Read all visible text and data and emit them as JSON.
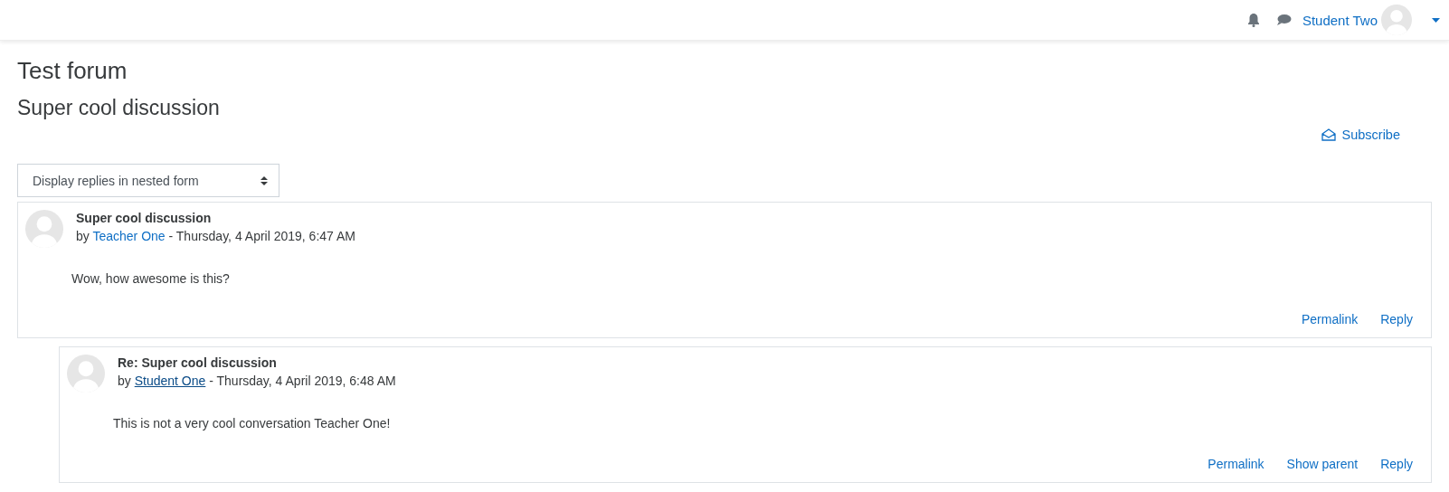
{
  "navbar": {
    "user_name": "Student Two"
  },
  "forum_title": "Test forum",
  "discussion_title": "Super cool discussion",
  "subscribe": "Subscribe",
  "display_mode": {
    "value": "Display replies in nested form"
  },
  "posts": [
    {
      "subject": "Super cool discussion",
      "by": "by",
      "author": "Teacher One",
      "author_hovered": false,
      "date": "- Thursday, 4 April 2019, 6:47 AM",
      "message": "Wow, how awesome is this?",
      "actions": [
        "Permalink",
        "Reply"
      ],
      "children": [
        {
          "subject": "Re: Super cool discussion",
          "by": "by",
          "author": "Student One",
          "author_hovered": true,
          "date": "- Thursday, 4 April 2019, 6:48 AM",
          "message": "This is not a very cool conversation Teacher One!",
          "actions": [
            "Permalink",
            "Show parent",
            "Reply"
          ]
        }
      ]
    }
  ]
}
